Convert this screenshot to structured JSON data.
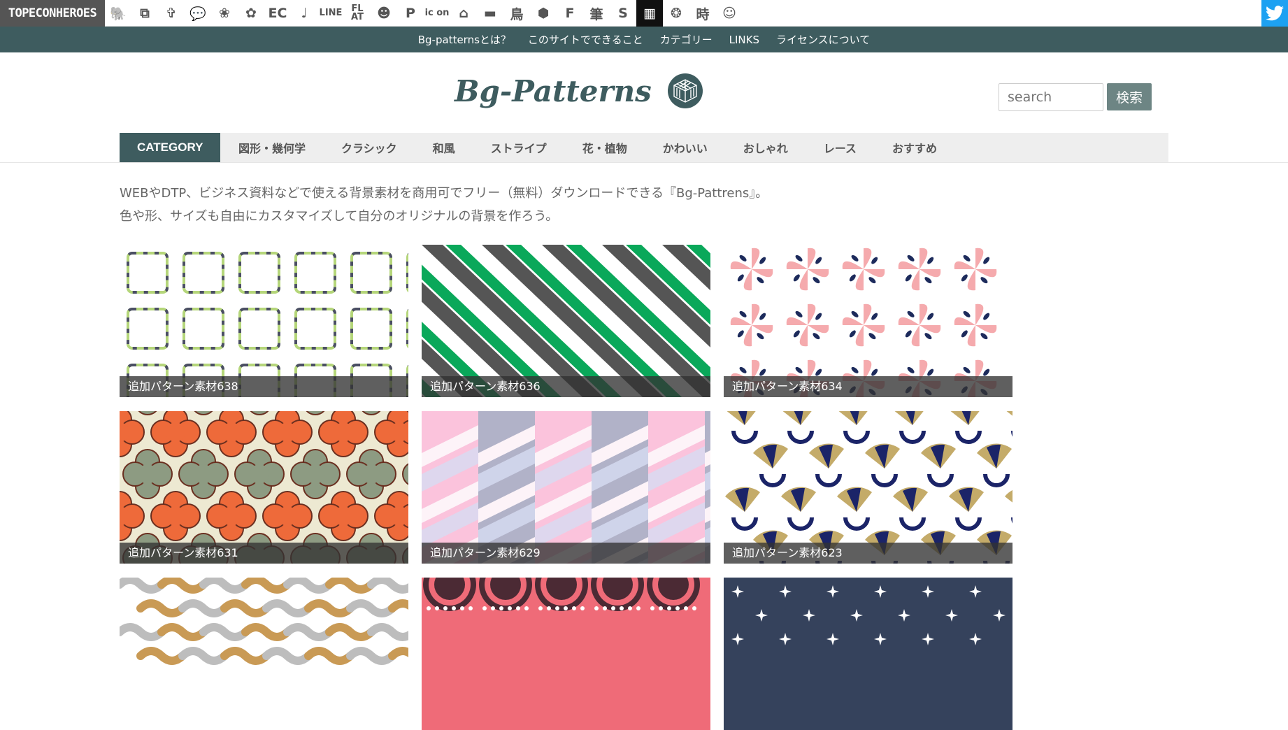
{
  "netbar": {
    "logo": "TOPECONHEROES",
    "icons": [
      {
        "name": "elephant-icon",
        "glyph": "🐘"
      },
      {
        "name": "copy-icon",
        "glyph": "⧉"
      },
      {
        "name": "person-icon",
        "glyph": "✞"
      },
      {
        "name": "chat-bubble-icon",
        "glyph": "💬"
      },
      {
        "name": "bird-icon",
        "glyph": "❀"
      },
      {
        "name": "flower-gear-icon",
        "glyph": "✿"
      },
      {
        "name": "ec-icon",
        "glyph": "EC"
      },
      {
        "name": "music-note-icon",
        "glyph": "♩"
      },
      {
        "name": "line-icon",
        "glyph": "LINE"
      },
      {
        "name": "flat-icon",
        "glyph": "FL AT"
      },
      {
        "name": "smiley-icon",
        "glyph": "☻"
      },
      {
        "name": "parking-icon",
        "glyph": "P"
      },
      {
        "name": "icon-text-icon",
        "glyph": "ic on"
      },
      {
        "name": "building-icon",
        "glyph": "⌂"
      },
      {
        "name": "sofa-icon",
        "glyph": "▬"
      },
      {
        "name": "tori-kanji-icon",
        "glyph": "鳥"
      },
      {
        "name": "hexagon-pattern-icon",
        "glyph": "⬢"
      },
      {
        "name": "f-font-icon",
        "glyph": "F"
      },
      {
        "name": "brush-kanji-icon",
        "glyph": "筆"
      },
      {
        "name": "s-font-icon",
        "glyph": "S"
      },
      {
        "name": "grid-pattern-icon",
        "glyph": "▦"
      },
      {
        "name": "burst-icon",
        "glyph": "❂"
      },
      {
        "name": "time-kanji-icon",
        "glyph": "時"
      },
      {
        "name": "face-icon",
        "glyph": "☺"
      }
    ],
    "twitter": "twitter-icon"
  },
  "subnav": [
    "Bg-patternsとは？",
    "このサイトでできること",
    "カテゴリー",
    "LINKS",
    "ライセンスについて"
  ],
  "brand": "Bg-Patterns",
  "search": {
    "placeholder": "search",
    "button": "検索"
  },
  "category": {
    "label": "CATEGORY",
    "items": [
      "図形・幾何学",
      "クラシック",
      "和風",
      "ストライプ",
      "花・植物",
      "かわいい",
      "おしゃれ",
      "レース",
      "おすすめ"
    ]
  },
  "intro": [
    "WEBやDTP、ビジネス資料などで使える背景素材を商用可でフリー（無料）ダウンロードできる『Bg-Pattrens』。",
    "色や形、サイズも自由にカスタマイズして自分のオリジナルの背景を作ろう。"
  ],
  "patterns": [
    {
      "caption": "追加パターン素材638",
      "colors": [
        "#ffffff",
        "#b5d67a",
        "#4a4e63"
      ]
    },
    {
      "caption": "追加パターン素材636",
      "colors": [
        "#ffffff",
        "#0aa85a",
        "#555555"
      ]
    },
    {
      "caption": "追加パターン素材634",
      "colors": [
        "#ffffff",
        "#f5aaad",
        "#1d2b5c"
      ]
    },
    {
      "caption": "追加パターン素材631",
      "colors": [
        "#ede9d2",
        "#ee6a3a",
        "#8d9b82"
      ]
    },
    {
      "caption": "追加パターン素材629",
      "colors": [
        "#fbc3dc",
        "#b1b2c8",
        "#d7dcf3"
      ]
    },
    {
      "caption": "追加パターン素材623",
      "colors": [
        "#ffffff",
        "#c4ab69",
        "#1b2468"
      ]
    },
    {
      "caption": "",
      "colors": [
        "#ffffff",
        "#c99a55",
        "#bdbdbd"
      ]
    },
    {
      "caption": "",
      "colors": [
        "#ef6b78",
        "#4b2a34",
        "#ffffff"
      ]
    },
    {
      "caption": "",
      "colors": [
        "#35425c",
        "#ffffff",
        "#35425c"
      ]
    }
  ]
}
